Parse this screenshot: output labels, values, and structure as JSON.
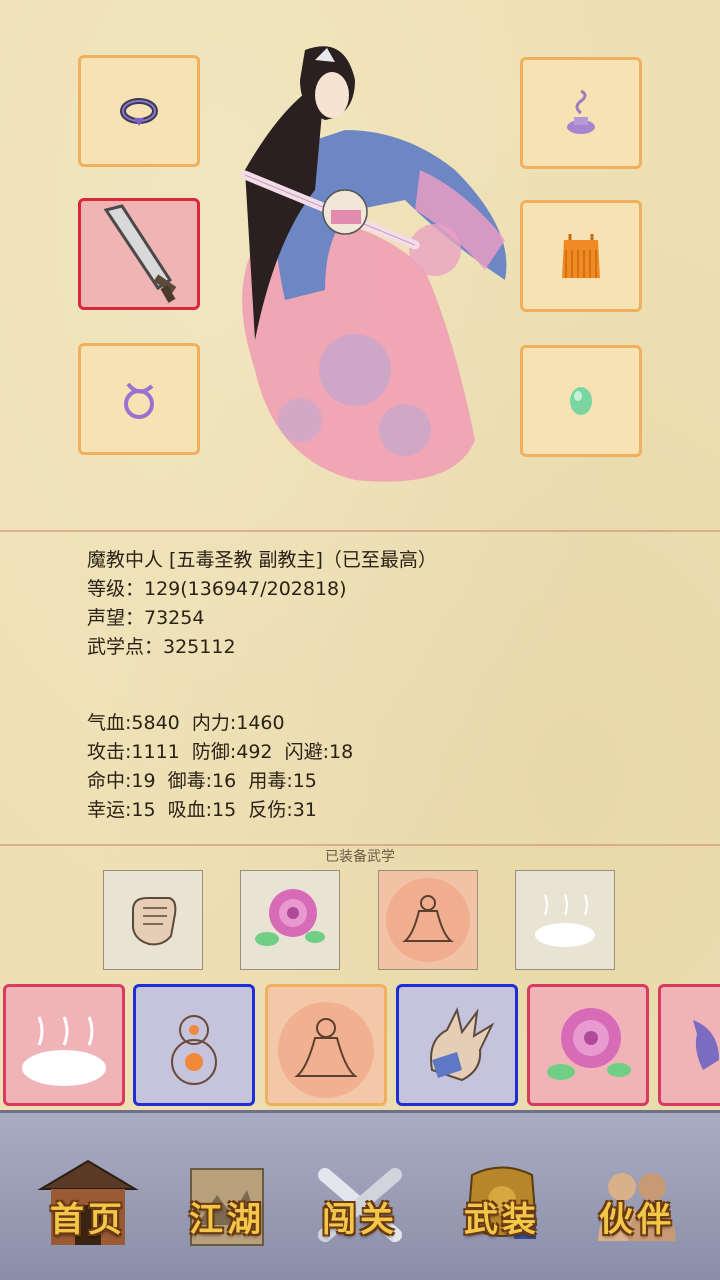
{
  "profile": {
    "title_line": "魔教中人 [五毒圣教 副教主]（已至最高）",
    "level_line": "等级：129(136947/202818)",
    "reputation_line": "声望：73254",
    "martial_points_line": "武学点：325112"
  },
  "stats": {
    "line1": "气血:5840  内力:1460",
    "line2": "攻击:1111  防御:492  闪避:18",
    "line3": "命中:19  御毒:16  用毒:15",
    "line4": "幸运:15  吸血:15  反伤:31"
  },
  "equipped_label": "已装备武学",
  "equipment_slots": [
    {
      "item": "ring-icon"
    },
    {
      "item": "incense-icon"
    },
    {
      "item": "broadsword-icon",
      "highlight": "red"
    },
    {
      "item": "robe-icon"
    },
    {
      "item": "bracelet-icon"
    },
    {
      "item": "jade-orb-icon"
    }
  ],
  "colors": {
    "slot_border": "#f0b060",
    "slot_red": "#d8283a",
    "skill_blue": "#1f2fd6",
    "skill_pink": "#d83a60",
    "skill_orange": "#f0b060",
    "nav_text": "#f3c84a"
  },
  "nav": [
    {
      "label": "首页",
      "icon": "pavilion-icon"
    },
    {
      "label": "江湖",
      "icon": "map-scroll-icon"
    },
    {
      "label": "闯关",
      "icon": "crossed-swords-icon"
    },
    {
      "label": "武装",
      "icon": "armor-icon"
    },
    {
      "label": "伙伴",
      "icon": "partners-icon"
    }
  ]
}
